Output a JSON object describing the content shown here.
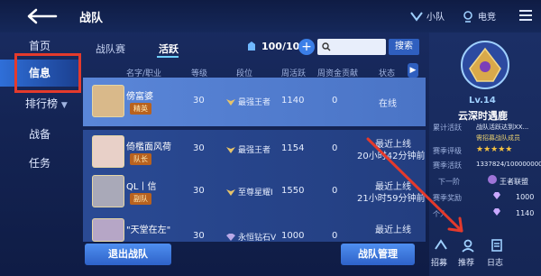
{
  "header": {
    "title": "战队",
    "right_items": [
      {
        "label": "小队"
      },
      {
        "label": "电竞"
      }
    ]
  },
  "left_nav": {
    "items": [
      {
        "label": "首页"
      },
      {
        "label": "信息"
      },
      {
        "label": "排行榜",
        "has_chevron": true
      },
      {
        "label": "战备"
      },
      {
        "label": "任务"
      }
    ]
  },
  "tabs": [
    {
      "label": "战队赛"
    },
    {
      "label": "活跃"
    }
  ],
  "activity": {
    "counter": "100/100"
  },
  "search": {
    "placeholder": "",
    "button_label": "搜索"
  },
  "table": {
    "headers": [
      "名字/职业",
      "等级",
      "段位",
      "周活跃",
      "周资金贡献",
      "状态"
    ],
    "rows": [
      {
        "name": "傍富婆",
        "role": "精英",
        "level": "30",
        "rank": "最强王者",
        "weekly_active": "1140",
        "weekly_funds": "0",
        "status": "在线",
        "status2": ""
      },
      {
        "name": "倚檻面风荷",
        "role": "队长",
        "level": "30",
        "rank": "最强王者",
        "weekly_active": "1154",
        "weekly_funds": "0",
        "status": "最近上线",
        "status2": "20小时42分钟前"
      },
      {
        "name": "QL丨信",
        "role": "副队",
        "level": "30",
        "rank": "至尊星耀I",
        "weekly_active": "1550",
        "weekly_funds": "0",
        "status": "最近上线",
        "status2": "21小时59分钟前"
      },
      {
        "name": "\"天堂在左\"",
        "role": "",
        "level": "30",
        "rank": "永恒钻石V",
        "weekly_active": "1000",
        "weekly_funds": "0",
        "status": "最近上线",
        "status2": ""
      }
    ]
  },
  "team_panel": {
    "level": "Lv.14",
    "name": "云深时遇鹿",
    "stats": [
      {
        "label": "累计活跃",
        "value": "战队活跃达到XX..."
      },
      {
        "label": "",
        "value": "需招募战队成员"
      },
      {
        "label": "赛季评级",
        "value": "★★★★★"
      },
      {
        "label": "赛季活跃",
        "value": "1337824/100000000"
      },
      {
        "label": "下一阶",
        "value": ""
      },
      {
        "label": "赛季奖励",
        "value": "1000"
      },
      {
        "label": "个人",
        "value": "1140"
      }
    ],
    "rank_badge": "王者联盟"
  },
  "buttons": {
    "leave": "退出战队",
    "manage": "战队管理"
  },
  "bottom_icons": [
    {
      "label": "招募"
    },
    {
      "label": "推荐"
    },
    {
      "label": "日志"
    }
  ],
  "colors": {
    "accent": "#3b7fe8",
    "highlight_box": "#e43a2c",
    "annotation_arrow": "#e43a2c",
    "role_badge": "#b8621f"
  }
}
